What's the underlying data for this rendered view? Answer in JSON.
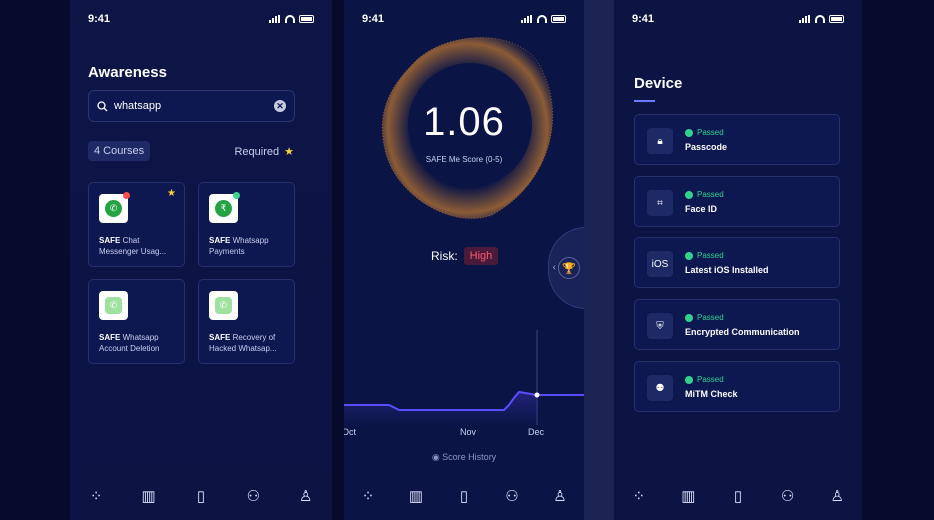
{
  "status": {
    "time": "9:41"
  },
  "awareness": {
    "title": "Awareness",
    "search": {
      "value": "whatsapp",
      "clear_label": "✕"
    },
    "count_label": "4 Courses",
    "required_label": "Required",
    "courses": [
      {
        "bold": "SAFE",
        "rest": " Chat Messenger Usag...",
        "badge_color": "#ff4d4d",
        "starred": true
      },
      {
        "bold": "SAFE",
        "rest": " Whatsapp Payments",
        "badge_color": "#3dd68c",
        "starred": false
      },
      {
        "bold": "SAFE",
        "rest": " Whatsapp Account Deletion",
        "badge_color": "",
        "starred": false
      },
      {
        "bold": "SAFE",
        "rest": " Recovery of Hacked Whatsap...",
        "badge_color": "",
        "starred": false
      }
    ]
  },
  "score": {
    "value": "1.06",
    "label": "SAFE Me Score (0-5)",
    "risk_label": "Risk:",
    "risk_value": "High",
    "months": [
      "Oct",
      "Nov",
      "Dec"
    ],
    "history_label": "Score History"
  },
  "device": {
    "title": "Device",
    "items": [
      {
        "status": "Passed",
        "name": "Passcode",
        "icon": "lock-icon"
      },
      {
        "status": "Passed",
        "name": "Face ID",
        "icon": "face-id-icon"
      },
      {
        "status": "Passed",
        "name": "Latest iOS Installed",
        "icon": "ios-icon",
        "icon_text": "iOS"
      },
      {
        "status": "Passed",
        "name": "Encrypted Communication",
        "icon": "ssl-shield-icon"
      },
      {
        "status": "Passed",
        "name": "MiTM Check",
        "icon": "mitm-icon"
      }
    ]
  },
  "colors": {
    "accent": "#6c7bff",
    "passed": "#32d18d",
    "risk_high": "#ff5a6d",
    "star": "#f8d23a"
  }
}
